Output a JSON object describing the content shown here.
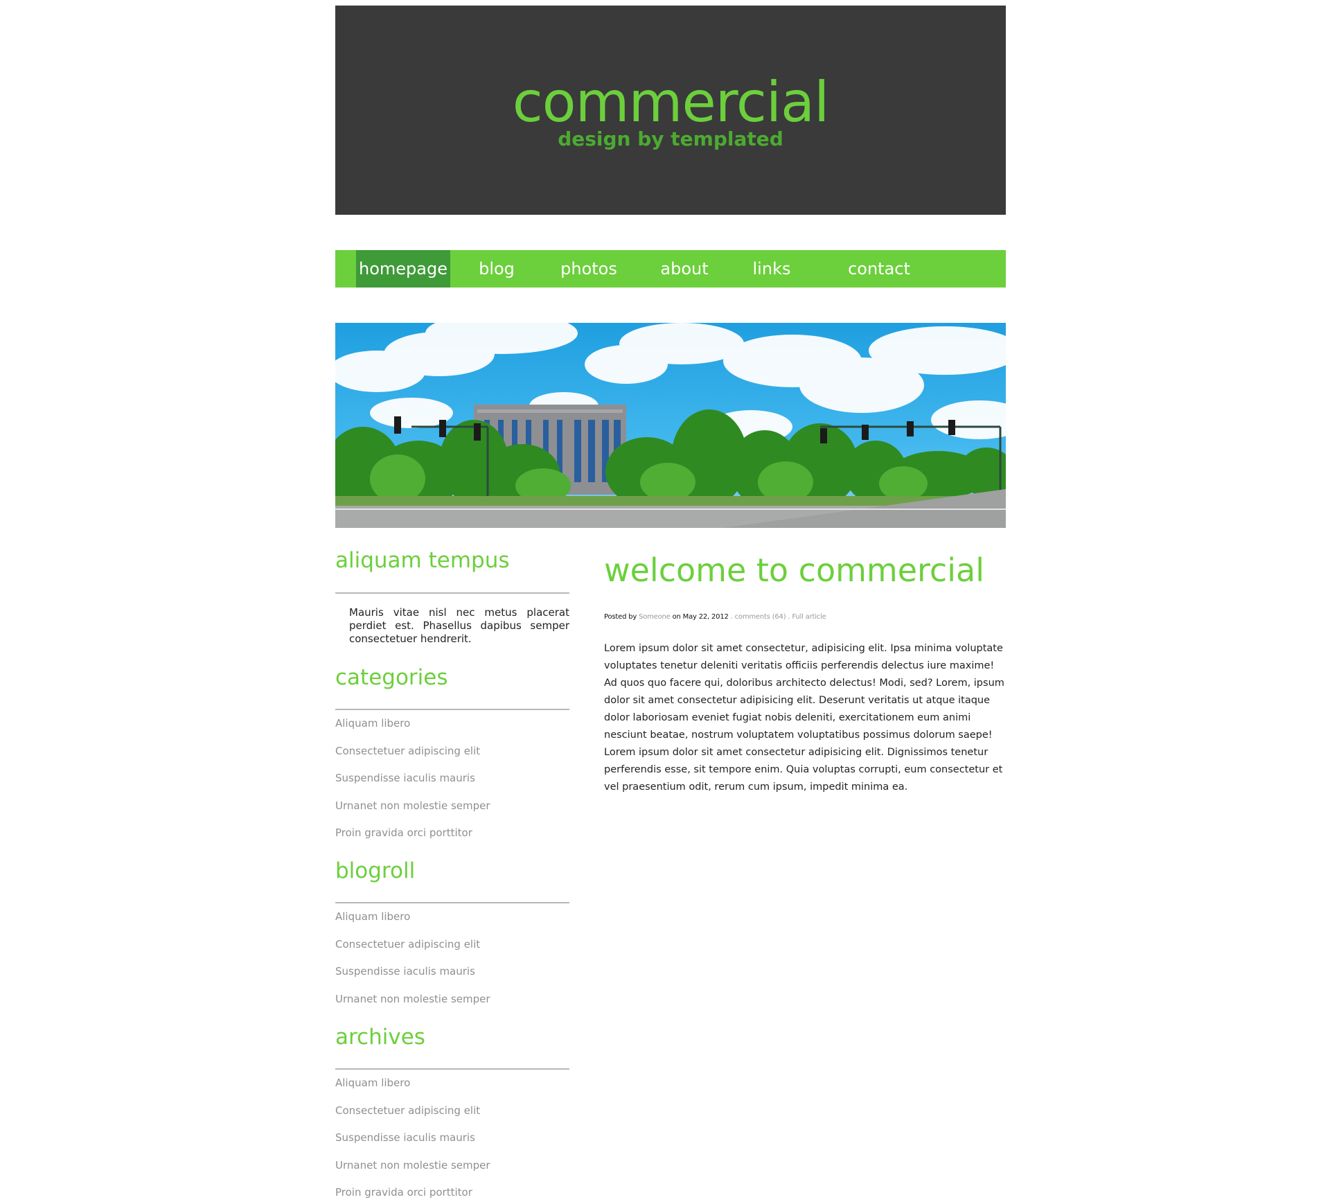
{
  "header": {
    "title": "commercial",
    "tagline": "design by templated"
  },
  "nav": {
    "items": [
      {
        "label": "homepage",
        "active": true
      },
      {
        "label": "blog"
      },
      {
        "label": "photos"
      },
      {
        "label": "about"
      },
      {
        "label": "links"
      },
      {
        "label": "contact"
      }
    ]
  },
  "colors": {
    "accent": "#6ccf3c",
    "nav_active": "#3f9a38",
    "header_bg": "#3a3a3a"
  },
  "sidebar": {
    "intro": {
      "title": "aliquam tempus",
      "text": "Mauris vitae nisl nec metus placerat perdiet est. Phasellus dapibus semper consectetuer hendrerit."
    },
    "categories": {
      "title": "categories",
      "items": [
        "Aliquam libero",
        "Consectetuer adipiscing elit",
        "Suspendisse iaculis mauris",
        "Urnanet non molestie semper",
        "Proin gravida orci porttitor"
      ]
    },
    "blogroll": {
      "title": "blogroll",
      "items": [
        "Aliquam libero",
        "Consectetuer adipiscing elit",
        "Suspendisse iaculis mauris",
        "Urnanet non molestie semper"
      ]
    },
    "archives": {
      "title": "archives",
      "items": [
        "Aliquam libero",
        "Consectetuer adipiscing elit",
        "Suspendisse iaculis mauris",
        "Urnanet non molestie semper",
        "Proin gravida orci porttitor"
      ]
    }
  },
  "post": {
    "title": "welcome to commercial",
    "meta": {
      "posted_by": "Posted by",
      "author": "Someone",
      "on": "on",
      "date": "May 22, 2012",
      "comments": ". comments (64)",
      "full_article": ". Full article"
    },
    "body": "Lorem ipsum dolor sit amet consectetur, adipisicing elit. Ipsa minima voluptate voluptates tenetur deleniti veritatis officiis perferendis delectus iure maxime! Ad quos quo facere qui, doloribus architecto delectus! Modi, sed? Lorem, ipsum dolor sit amet consectetur adipisicing elit. Deserunt veritatis ut atque itaque dolor laboriosam eveniet fugiat nobis deleniti, exercitationem eum animi nesciunt beatae, nostrum voluptatem voluptatibus possimus dolorum saepe! Lorem ipsum dolor sit amet consectetur adipisicing elit. Dignissimos tenetur perferendis esse, sit tempore enim. Quia voluptas corrupti, eum consectetur et vel praesentium odit, rerum cum ipsum, impedit minima ea."
  }
}
